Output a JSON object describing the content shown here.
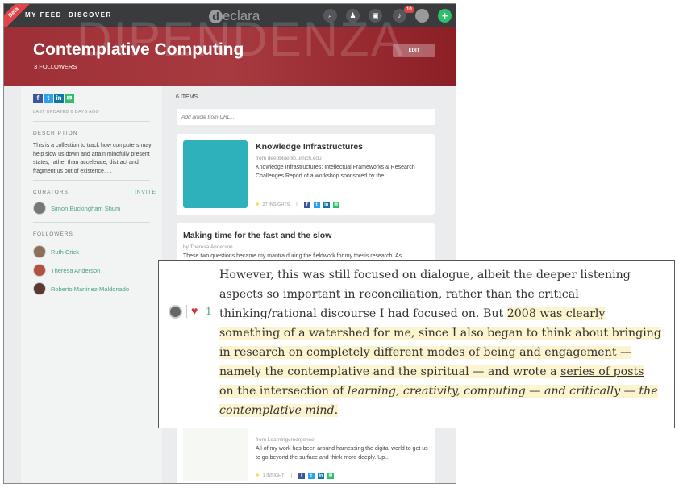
{
  "nav": {
    "beta": "Beta",
    "links": [
      "MY FEED",
      "DISCOVER"
    ],
    "logo": "declara",
    "notifications": "10",
    "icons": [
      "search-icon",
      "people-icon",
      "inbox-icon",
      "bell-icon",
      "avatar",
      "plus-icon"
    ]
  },
  "banner": {
    "bg_text": "DIPENDENZA",
    "title": "Contemplative Computing",
    "followers": "3 FOLLOWERS",
    "edit": "EDIT"
  },
  "sidebar": {
    "last_updated": "LAST UPDATED 6 DAYS AGO",
    "description_label": "DESCRIPTION",
    "description": "This is a collection to track how computers may help slow us down and attain mindfully present states, rather than accelerate, distract and fragment us out of existence. . .",
    "curators_label": "CURATORS",
    "invite": "INVITE",
    "curators": [
      "Simon Buckingham Shum"
    ],
    "followers_label": "FOLLOWERS",
    "followers": [
      "Ruth Crick",
      "Theresa Anderson",
      "Roberto Martinez-Maldonado"
    ]
  },
  "main": {
    "count": "6 ITEMS",
    "url_placeholder": "Add article from URL...",
    "cards": [
      {
        "title": "Knowledge Infrastructures",
        "from": "from deepblue.lib.umich.edu",
        "desc": "Knowledge Infrastructures: Intellectual Frameworks & Research Challenges Report of a workshop sponsored by the...",
        "insights": "27 INSIGHTS"
      },
      {
        "title": "Making time for the fast and the slow",
        "from": "by Theresa Anderson",
        "desc": "These two questions became my mantra during the fieldwork for my thesis research. As"
      },
      {
        "from": "from Learningemergence",
        "desc": "All of my work has been around harnessing the digital world to get us to go beyond the surface and think more deeply. Up...",
        "insights": "1 INSIGHT"
      }
    ]
  },
  "overlay": {
    "likes": "1",
    "lines": [
      "However, this was still focused on dialogue, albeit the deeper listening",
      "aspects so important in reconciliation, rather than the critical",
      "thinking/rational discourse I had focused on. But ",
      "2008 was clearly",
      "something of a watershed for me, since I also began to think about bringing",
      "in research on completely different modes of being and engagement —",
      "namely the contemplative and the spiritual — and wrote a ",
      "series of posts",
      "on the intersection of ",
      "learning, creativity, computing — and critically — the",
      "contemplative mind",
      "."
    ]
  },
  "colors": {
    "accent": "#4aa37e",
    "banner": "#9e2f36",
    "highlight": "#fcf3cf",
    "heart": "#d6333a"
  }
}
